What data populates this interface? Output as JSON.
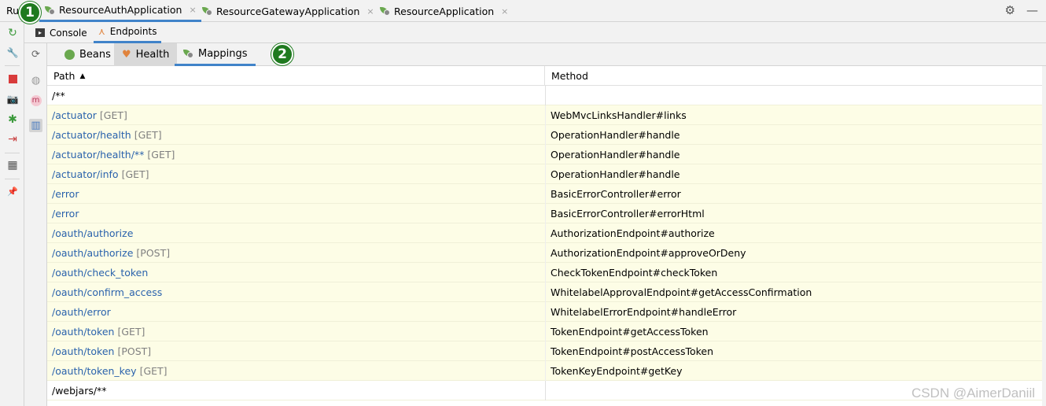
{
  "run_label": "Ru",
  "run_tabs": [
    {
      "label": "ResourceAuthApplication",
      "active": true
    },
    {
      "label": "ResourceGatewayApplication",
      "active": false
    },
    {
      "label": "ResourceApplication",
      "active": false
    }
  ],
  "close_glyph": "×",
  "badges": {
    "one": "1",
    "two": "2"
  },
  "subtabs": {
    "console": "Console",
    "endpoints": "Endpoints"
  },
  "endpoint_tabs": {
    "beans": "Beans",
    "health": "Health",
    "mappings": "Mappings"
  },
  "columns": {
    "path": "Path",
    "method": "Method"
  },
  "rows": [
    {
      "path": "/**",
      "verb": "",
      "handler": "",
      "highlight": false,
      "link": false
    },
    {
      "path": "/actuator",
      "verb": "[GET]",
      "handler": "WebMvcLinksHandler#links",
      "highlight": true,
      "link": true
    },
    {
      "path": "/actuator/health",
      "verb": "[GET]",
      "handler": "OperationHandler#handle",
      "highlight": true,
      "link": true
    },
    {
      "path": "/actuator/health/**",
      "verb": "[GET]",
      "handler": "OperationHandler#handle",
      "highlight": true,
      "link": true
    },
    {
      "path": "/actuator/info",
      "verb": "[GET]",
      "handler": "OperationHandler#handle",
      "highlight": true,
      "link": true
    },
    {
      "path": "/error",
      "verb": "",
      "handler": "BasicErrorController#error",
      "highlight": true,
      "link": true
    },
    {
      "path": "/error",
      "verb": "",
      "handler": "BasicErrorController#errorHtml",
      "highlight": true,
      "link": true
    },
    {
      "path": "/oauth/authorize",
      "verb": "",
      "handler": "AuthorizationEndpoint#authorize",
      "highlight": true,
      "link": true
    },
    {
      "path": "/oauth/authorize",
      "verb": "[POST]",
      "handler": "AuthorizationEndpoint#approveOrDeny",
      "highlight": true,
      "link": true
    },
    {
      "path": "/oauth/check_token",
      "verb": "",
      "handler": "CheckTokenEndpoint#checkToken",
      "highlight": true,
      "link": true
    },
    {
      "path": "/oauth/confirm_access",
      "verb": "",
      "handler": "WhitelabelApprovalEndpoint#getAccessConfirmation",
      "highlight": true,
      "link": true
    },
    {
      "path": "/oauth/error",
      "verb": "",
      "handler": "WhitelabelErrorEndpoint#handleError",
      "highlight": true,
      "link": true
    },
    {
      "path": "/oauth/token",
      "verb": "[GET]",
      "handler": "TokenEndpoint#getAccessToken",
      "highlight": true,
      "link": true
    },
    {
      "path": "/oauth/token",
      "verb": "[POST]",
      "handler": "TokenEndpoint#postAccessToken",
      "highlight": true,
      "link": true
    },
    {
      "path": "/oauth/token_key",
      "verb": "[GET]",
      "handler": "TokenKeyEndpoint#getKey",
      "highlight": true,
      "link": true
    },
    {
      "path": "/webjars/**",
      "verb": "",
      "handler": "",
      "highlight": false,
      "link": false
    }
  ],
  "watermark": "CSDN @AimerDaniil",
  "icon_glyphs": {
    "gear": "⚙",
    "minimize": "—",
    "rerun": "↻",
    "wrench": "🔧",
    "camera": "📷",
    "bug": "✱",
    "exit": "⇥",
    "layout": "▦",
    "pin": "📌",
    "refresh": "⟳",
    "globe": "◍",
    "m": "m",
    "chart": "▥",
    "sort_up": "▲",
    "heart": "♥",
    "console": "▸"
  }
}
